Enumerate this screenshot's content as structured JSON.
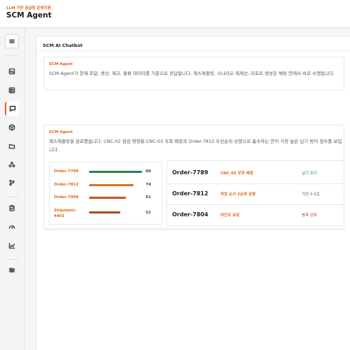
{
  "header": {
    "subtitle": "LLM 기반 공급망 운영지원",
    "title": "SCM Agent"
  },
  "sidebar": {
    "items": [
      {
        "name": "menu-toggle-button",
        "icon": "menu-icon"
      },
      {
        "name": "sidebar-item-image",
        "icon": "image-icon"
      },
      {
        "name": "sidebar-item-table",
        "icon": "table-icon"
      },
      {
        "name": "sidebar-item-chat",
        "icon": "chat-icon",
        "active": true
      },
      {
        "name": "sidebar-item-box",
        "icon": "cube-icon"
      },
      {
        "name": "sidebar-item-folder",
        "icon": "folder-icon"
      },
      {
        "name": "sidebar-item-network",
        "icon": "network-icon"
      },
      {
        "name": "sidebar-item-branch",
        "icon": "branch-icon"
      },
      {
        "name": "sidebar-item-clipboard",
        "icon": "clipboard-icon"
      },
      {
        "name": "sidebar-item-gauge",
        "icon": "gauge-icon"
      },
      {
        "name": "sidebar-item-chart",
        "icon": "line-chart-icon"
      },
      {
        "name": "sidebar-item-settings",
        "icon": "sliders-icon"
      }
    ]
  },
  "chat": {
    "title": "SCM AI Chatbot",
    "messages": [
      {
        "sender": "SCM Agent",
        "text": "SCM Agent가 현재 조달, 생산, 재고, 물류 데이터를 기준으로 응답합니다. 재스케줄링, 시나리오 재계산, 리포트 생성은 채팅 안에서 바로 수행됩니다."
      },
      {
        "sender": "SCM Agent",
        "text": "재스케줄링을 완료했습니다. CNC-02 점검 영향을 CNC-03 우회 배정과 Order-7812 우선순위 상향으로 흡수하는 안이 가장 높은 납기 방어 점수를 보입니다."
      }
    ],
    "scores": [
      {
        "label": "Order-7789",
        "value": 88,
        "color": "#2e7d4f"
      },
      {
        "label": "Order-7812",
        "value": 74,
        "color": "#e07018"
      },
      {
        "label": "Order-7804",
        "value": 61,
        "color": "#c2571a"
      },
      {
        "label": "Shipment-4401",
        "value": 52,
        "color": "#b0480f"
      }
    ],
    "plan": [
      {
        "order": "Order-7789",
        "action": "CNC-03 우회 배정",
        "result": "납기 유지",
        "result_color": "#2e7d4f"
      },
      {
        "order": "Order-7812",
        "action": "작업 순서 2순위 상향",
        "result": "지연 0.5일",
        "result_color": "#666666"
      },
      {
        "order": "Order-7804",
        "action": "야간조 보강",
        "result": "병목 완화",
        "result_color": "#c0392b"
      }
    ]
  }
}
